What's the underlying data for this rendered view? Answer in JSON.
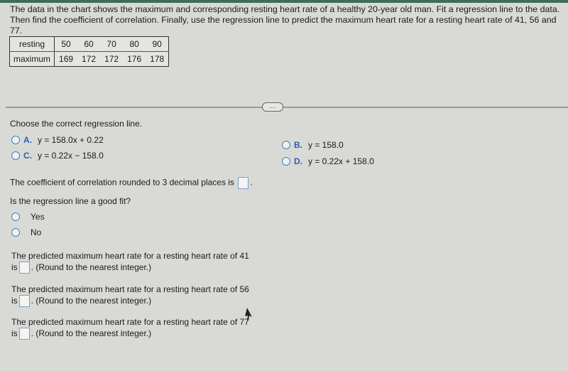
{
  "intro": {
    "line1": "The data in the chart shows the maximum and corresponding resting heart rate of a healthy 20-year old man. Fit a regression line to the data.",
    "line2": "Then find the coefficient of correlation. Finally, use the regression line to predict the maximum heart rate for a resting heart rate of 41, 56 and 77."
  },
  "table": {
    "rows": [
      {
        "label": "resting",
        "values": [
          "50",
          "60",
          "70",
          "80",
          "90"
        ]
      },
      {
        "label": "maximum",
        "values": [
          "169",
          "172",
          "172",
          "176",
          "178"
        ]
      }
    ]
  },
  "more_button": "....",
  "q1": {
    "prompt": "Choose the correct regression line.",
    "options": [
      {
        "letter": "A.",
        "text": "y = 158.0x + 0.22"
      },
      {
        "letter": "B.",
        "text": "y = 158.0"
      },
      {
        "letter": "C.",
        "text": "y = 0.22x − 158.0"
      },
      {
        "letter": "D.",
        "text": "y = 0.22x + 158.0"
      }
    ]
  },
  "q2": {
    "prompt": "The coefficient of correlation rounded to 3 decimal places is",
    "suffix": "."
  },
  "q3": {
    "prompt": "Is the regression line a good fit?",
    "options": [
      "Yes",
      "No"
    ]
  },
  "predictions": [
    {
      "line1": "The predicted maximum heart rate for a resting heart rate of 41",
      "is": "is",
      "hint": ". (Round to the nearest integer.)"
    },
    {
      "line1": "The predicted maximum heart rate for a resting heart rate of 56",
      "is": "is",
      "hint": ". (Round to the nearest integer.)"
    },
    {
      "line1": "The predicted maximum heart rate for a resting heart rate of 77",
      "is": "is",
      "hint": ". (Round to the nearest integer.)"
    }
  ],
  "colors": {
    "accent": "#2b5fa8",
    "radio": "#3f7fc0",
    "background": "#d9dad6"
  }
}
